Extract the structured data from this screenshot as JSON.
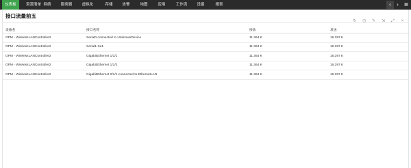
{
  "nav": {
    "tabs": [
      {
        "label": "仪表板",
        "active": true
      },
      {
        "label": "资源清单",
        "active": false
      },
      {
        "label": "网络",
        "active": false
      },
      {
        "label": "服务器",
        "active": false
      },
      {
        "label": "虚拟化",
        "active": false
      },
      {
        "label": "存储",
        "active": false
      },
      {
        "label": "告警",
        "active": false
      },
      {
        "label": "地图",
        "active": false
      },
      {
        "label": "应用",
        "active": false
      },
      {
        "label": "工作流",
        "active": false
      },
      {
        "label": "设置",
        "active": false
      },
      {
        "label": "报表",
        "active": false
      }
    ],
    "prev_icon": "chevron-left-icon",
    "next_icon": "chevron-right-icon",
    "menu_icon": "grid-menu-icon"
  },
  "widget": {
    "title": "接口流量前五",
    "tools": [
      "refresh-icon",
      "clock-icon",
      "edit-icon",
      "export-icon",
      "expand-icon",
      "close-icon"
    ]
  },
  "table": {
    "columns": [
      "设备名",
      "接口名称",
      "接收",
      "发送"
    ],
    "rows": [
      [
        "OPM - WirelessLANController2",
        "Serial0-connected to UnknownDevice",
        "11.364 K",
        "16.397 K"
      ],
      [
        "OPM - WirelessLANController2",
        "Serial1-Se1",
        "11.364 K",
        "16.397 K"
      ],
      [
        "OPM - WirelessLANController2",
        "GigabitEthernet 1/1/1",
        "11.364 K",
        "16.397 K"
      ],
      [
        "OPM - WirelessLANController2",
        "GigabitEthernet 1/1/2",
        "11.364 K",
        "16.397 K"
      ],
      [
        "OPM - WirelessLANController2",
        "GigabitEthernet 0/1/1-connected to EthernetLAN",
        "11.364 K",
        "16.397 K"
      ]
    ]
  }
}
